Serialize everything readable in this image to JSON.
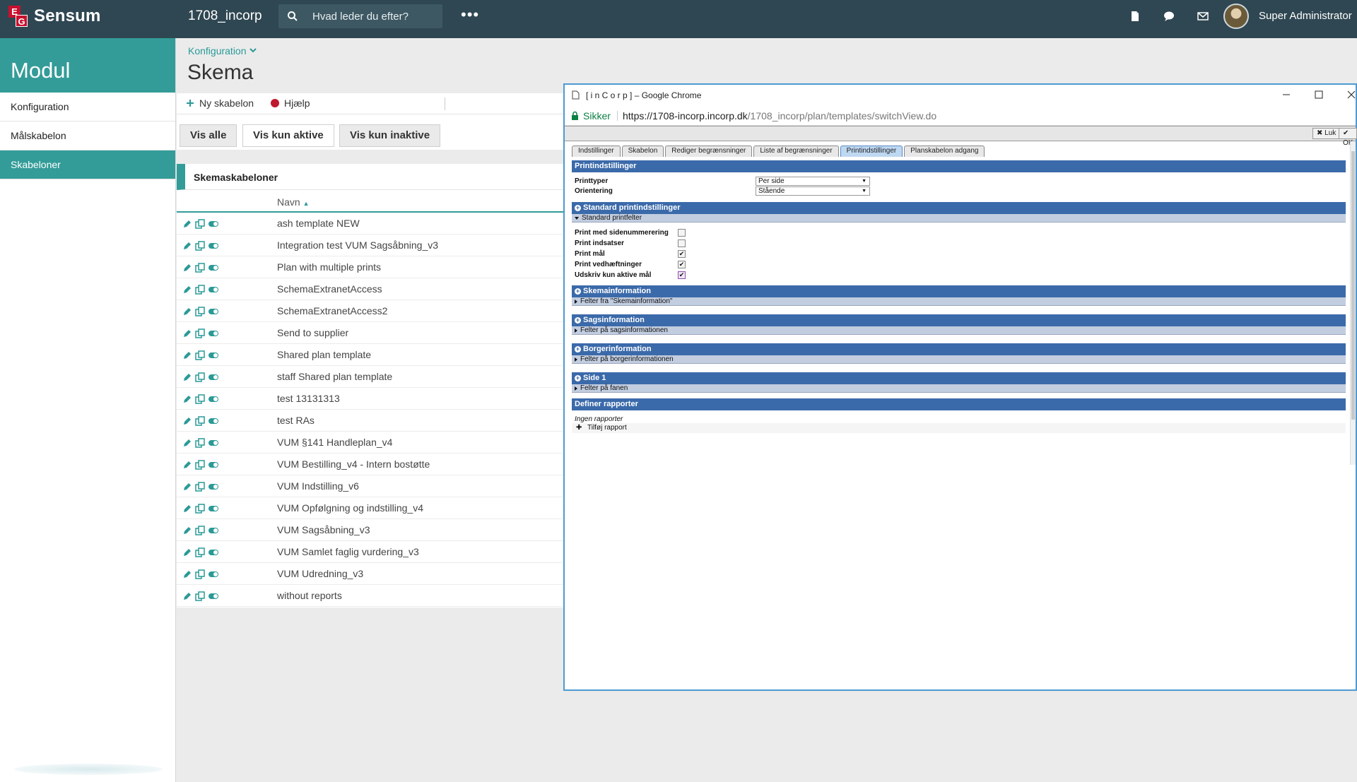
{
  "header": {
    "brand": "Sensum",
    "logo_e": "E",
    "logo_g": "G",
    "instance": "1708_incorp",
    "search_placeholder": "Hvad leder du efter?",
    "more": "•••",
    "user": "Super Administrator"
  },
  "sidebar": {
    "title": "Modul",
    "items": [
      {
        "label": "Konfiguration"
      },
      {
        "label": "Målskabelon"
      },
      {
        "label": "Skabeloner"
      }
    ]
  },
  "main": {
    "breadcrumb": "Konfiguration",
    "title": "Skema",
    "toolbar": {
      "new_label": "Ny skabelon",
      "help_label": "Hjælp"
    },
    "filters": [
      "Vis alle",
      "Vis kun aktive",
      "Vis kun inaktive"
    ],
    "panel_title": "Skemaskabeloner",
    "column_name": "Navn",
    "rows": [
      "ash template NEW",
      "Integration test VUM Sagsåbning_v3",
      "Plan with multiple prints",
      "SchemaExtranetAccess",
      "SchemaExtranetAccess2",
      "Send to supplier",
      "Shared plan template",
      "staff Shared plan template",
      "test 13131313",
      "test RAs",
      "VUM §141 Handleplan_v4",
      "VUM Bestilling_v4 - Intern bostøtte",
      "VUM Indstilling_v6",
      "VUM Opfølgning og indstilling_v4",
      "VUM Sagsåbning_v3",
      "VUM Samlet faglig vurdering_v3",
      "VUM Udredning_v3",
      "without reports"
    ]
  },
  "popup": {
    "window_title": "[ i n C o r p ] – Google Chrome",
    "secure": "Sikker",
    "url_host": "https://1708-incorp.incorp.dk",
    "url_path": "/1708_incorp/plan/templates/switchView.do",
    "close_btn": "Luk",
    "ok_btn": "OK",
    "tabs": [
      "Indstillinger",
      "Skabelon",
      "Rediger begrænsninger",
      "Liste af begrænsninger",
      "Printindstillinger",
      "Planskabelon adgang"
    ],
    "print_settings_title": "Printindstillinger",
    "print_types_label": "Printtyper",
    "print_types_value": "Per side",
    "orientation_label": "Orientering",
    "orientation_value": "Stående",
    "standard_section": "Standard printindstillinger",
    "standard_sub": "Standard printfelter",
    "checks": [
      {
        "label": "Print med sidenummerering",
        "checked": false
      },
      {
        "label": "Print indsatser",
        "checked": false
      },
      {
        "label": "Print mål",
        "checked": true
      },
      {
        "label": "Print vedhæftninger",
        "checked": true
      },
      {
        "label": "Udskriv kun aktive mål",
        "checked": true
      }
    ],
    "sections": [
      {
        "title": "Skemainformation",
        "sub": "Felter fra \"Skemainformation\""
      },
      {
        "title": "Sagsinformation",
        "sub": "Felter på sagsinformationen"
      },
      {
        "title": "Borgerinformation",
        "sub": "Felter på borgerinformationen"
      },
      {
        "title": "Side 1",
        "sub": "Felter på fanen"
      }
    ],
    "reports_title": "Definer rapporter",
    "no_reports": "Ingen rapporter",
    "add_report": "Tilføj rapport"
  }
}
